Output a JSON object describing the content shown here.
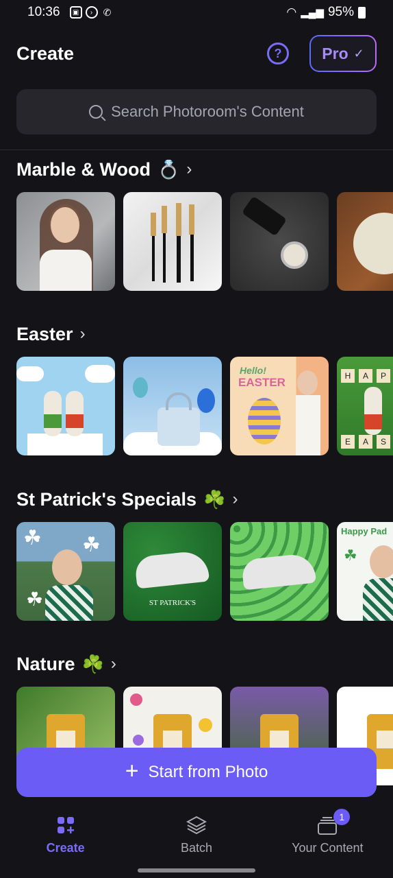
{
  "status": {
    "time": "10:36",
    "battery": "95%"
  },
  "header": {
    "title": "Create",
    "pro_label": "Pro"
  },
  "search": {
    "placeholder": "Search Photoroom's Content"
  },
  "sections": [
    {
      "title": "Marble & Wood",
      "emoji": "💍"
    },
    {
      "title": "Easter",
      "emoji": ""
    },
    {
      "title": "St Patrick's Specials",
      "emoji": "☘️"
    },
    {
      "title": "Nature",
      "emoji": "☘️"
    }
  ],
  "tiles": {
    "easter_text_1": "Hello!",
    "easter_text_2": "EASTER",
    "stpatricks_text": "ST PATRICK'S",
    "happy_text": "Happy Pad",
    "scrabble_top": [
      "H",
      "A",
      "P"
    ],
    "scrabble_bottom": [
      "E",
      "A",
      "S"
    ]
  },
  "cta": {
    "label": "Start from Photo"
  },
  "nav": {
    "create": "Create",
    "batch": "Batch",
    "your_content": "Your Content",
    "badge": "1"
  },
  "colors": {
    "accent": "#6c5cf6",
    "background": "#141418",
    "surface": "#26262c"
  }
}
